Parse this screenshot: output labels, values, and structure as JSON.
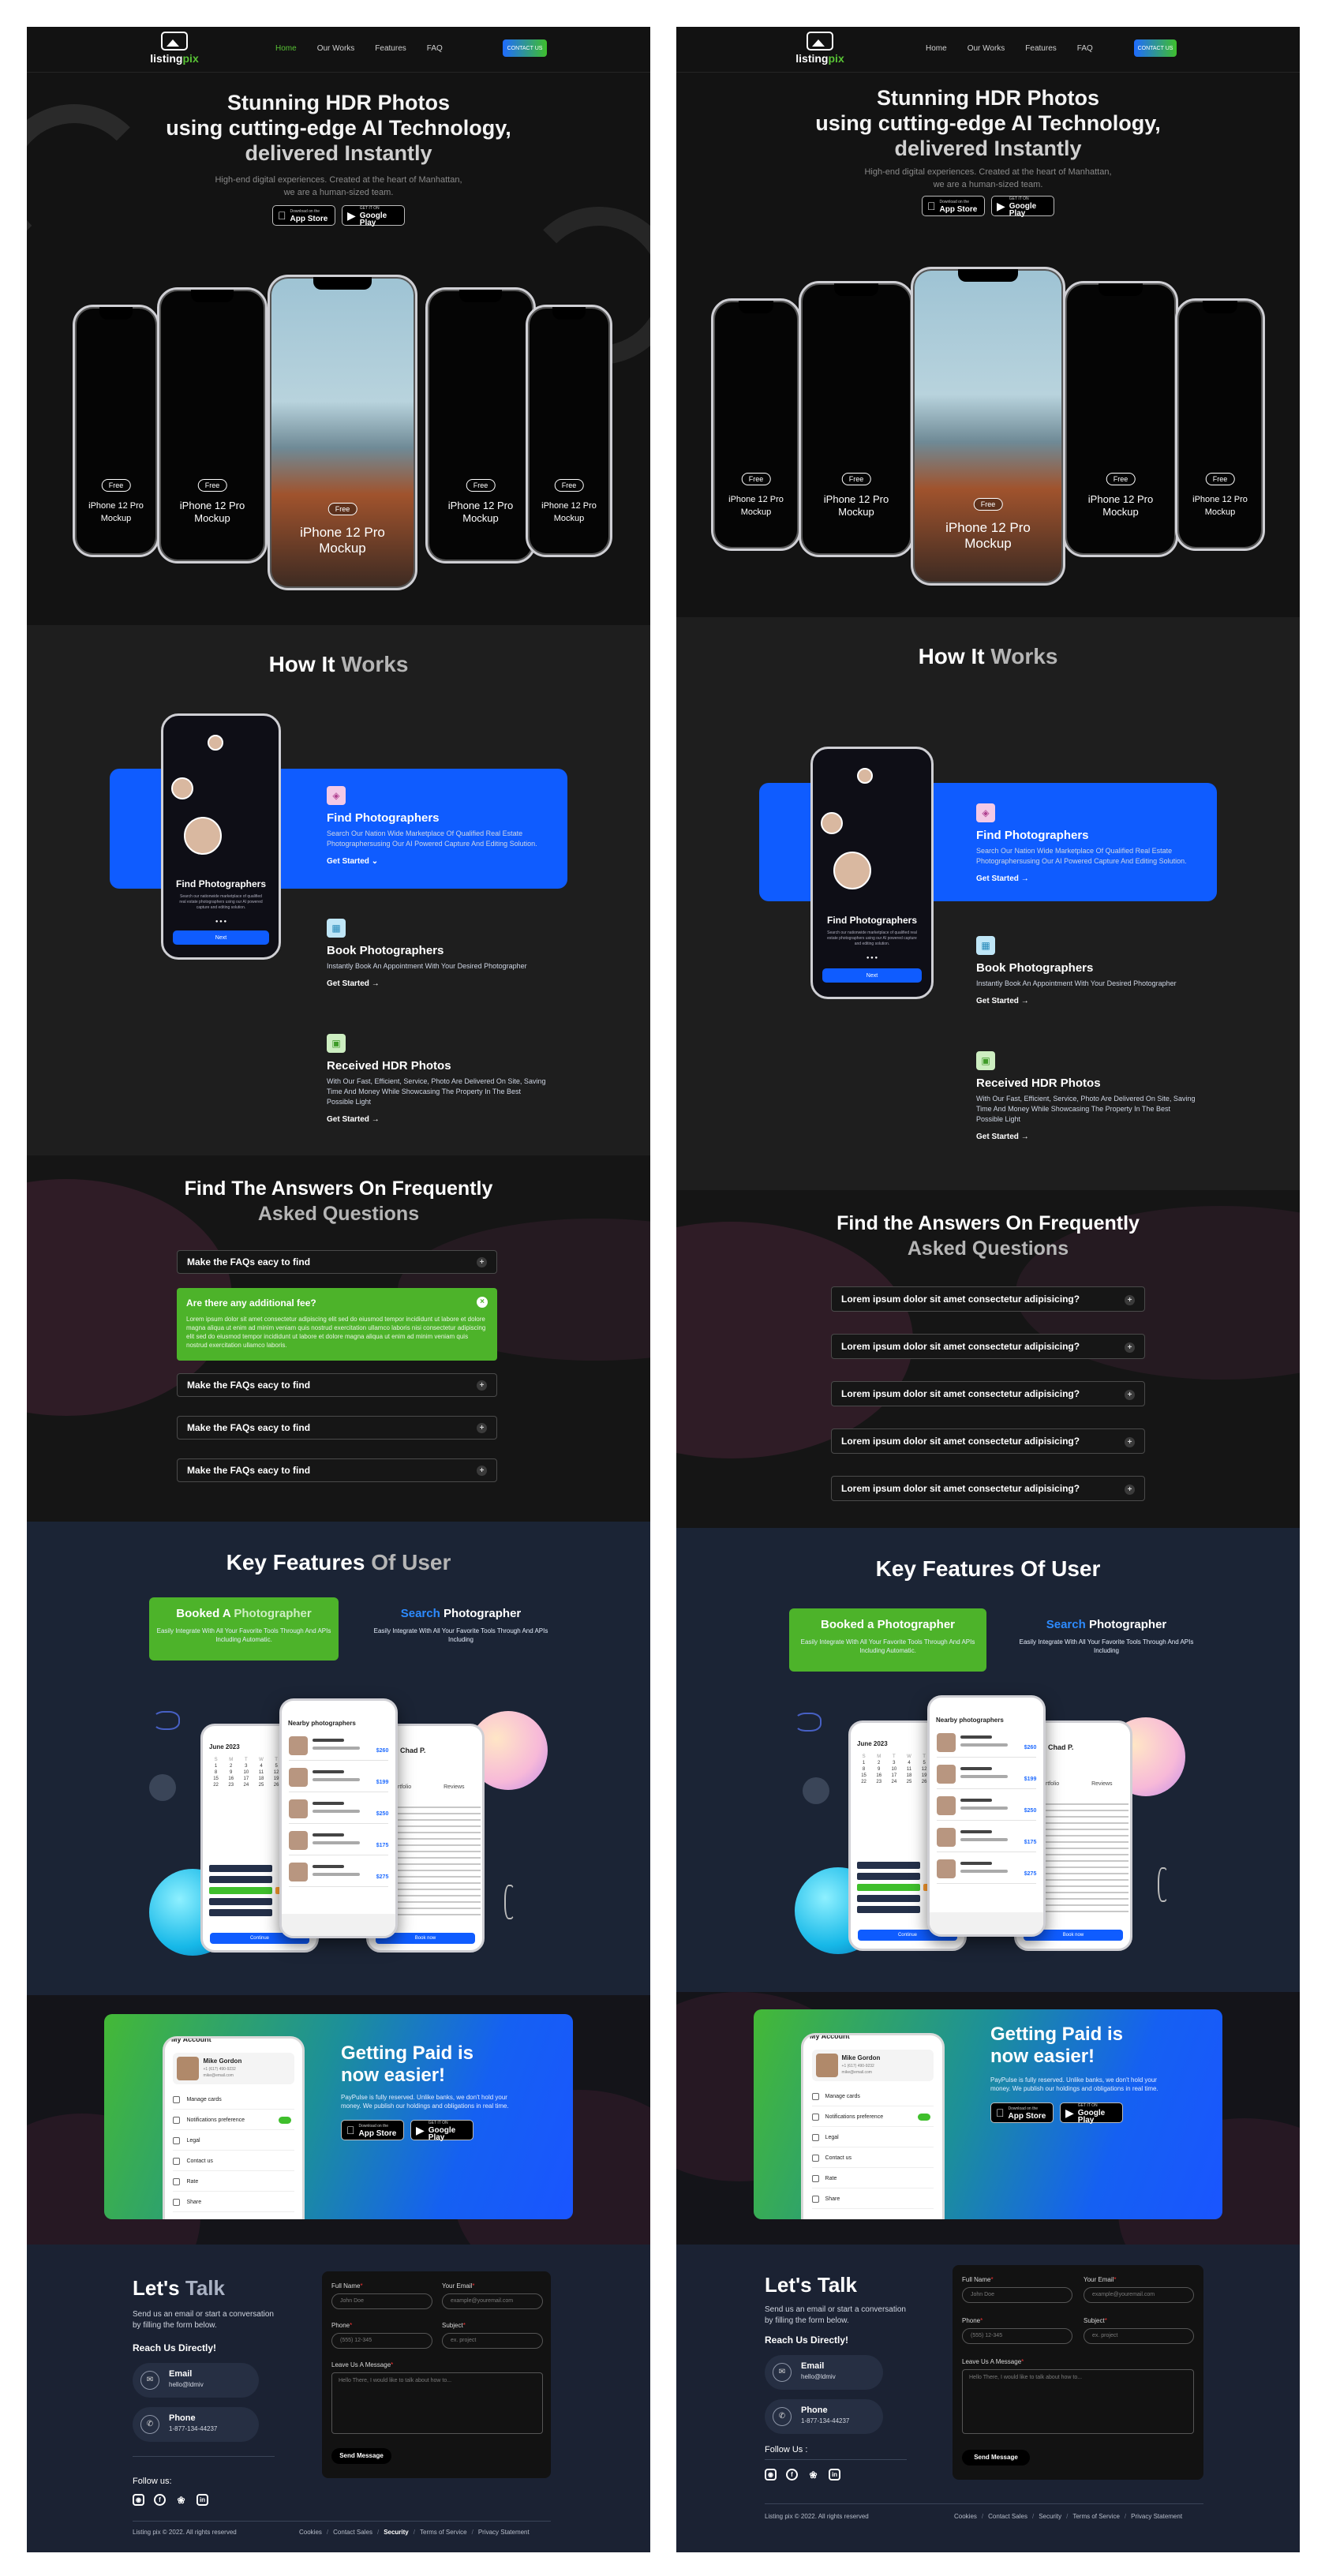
{
  "nav": {
    "logo": {
      "word_main": "listing",
      "word_accent": "pix"
    },
    "links": [
      "Home",
      "Our Works",
      "Features",
      "FAQ"
    ],
    "contact_button": "CONTACT US"
  },
  "hero": {
    "title_line1": "Stunning HDR Photos",
    "title_line2": "using cutting-edge AI Technology,",
    "title_line3": "delivered Instantly",
    "subtitle": "High-end digital experiences. Created at the heart of Manhattan, we are a human-sized team.",
    "app_store_small": "Download on the",
    "app_store_big": "App Store",
    "google_play_small": "GET IT ON",
    "google_play_big": "Google Play",
    "phone_badge": "Free",
    "phone_label_line1": "iPhone 12 Pro",
    "phone_label_line2": "Mockup"
  },
  "how": {
    "title_main": "How It",
    "title_dim": "Works",
    "phone_title": "Find Photographers",
    "phone_desc": "Search our nationwide marketplace of qualified real estate photographers using our AI powered capture and editing solution.",
    "phone_dots": "● ● ●",
    "phone_button": "Next",
    "steps": [
      {
        "title": "Find Photographers",
        "cta": "Get Started"
      },
      {
        "title": "Book Photographers",
        "desc": "Instantly Book An Appointment With Your Desired Photographer",
        "cta": "Get Started"
      },
      {
        "title": "Received HDR Photos",
        "desc": "With Our Fast, Efficient, Service, Photo Are Delivered On Site, Saving Time And Money While Showcasing The Property In The Best Possible Light",
        "cta": "Get Started"
      }
    ],
    "step1_desc_left": "Search Our Nation Wide Marketplace Of Qualified Real Estate Photographersusing Our AI Powered Capture And Editing Solution.",
    "step1_desc_right": "Search Our Nation Wide Marketplace Of Qualified Real Estate Photographersusing Our AI Powered Capture And Editing Solution."
  },
  "faq_left": {
    "title_line1": "Find The Answers On Frequently",
    "title_line2": "Asked Questions",
    "item1": "Make the FAQs eacy to find",
    "open_question": "Are there any additional fee?",
    "open_answer": "Lorem ipsum dolor sit amet consectetur adipiscing elit sed do eiusmod tempor incididunt ut labore et dolore magna aliqua ut enim ad minim veniam quis nostrud exercitation ullamco laboris nisi consectetur adipiscing elit sed do eiusmod tempor incididunt ut labore et dolore magna aliqua ut enim ad minim veniam quis nostrud exercitation ullamco laboris.",
    "item3": "Make the FAQs eacy to find",
    "item4": "Make the FAQs eacy to find",
    "item5": "Make the FAQs eacy to find"
  },
  "faq_right": {
    "title_line1": "Find the Answers On Frequently",
    "title_line2": "Asked Questions",
    "items": [
      "Lorem ipsum dolor sit amet consectetur adipisicing?",
      "Lorem ipsum dolor sit amet consectetur adipisicing?",
      "Lorem ipsum dolor sit amet consectetur adipisicing?",
      "Lorem ipsum dolor sit amet consectetur adipisicing?",
      "Lorem ipsum dolor sit amet consectetur adipisicing?"
    ]
  },
  "features": {
    "title_main": "Key Features",
    "title_dim": "Of User",
    "tab1_accent_left": "Booked A",
    "tab1_rest_left": "Photographer",
    "tab1_right": "Booked a Photographer",
    "tab1_desc": "Easily Integrate With All Your Favorite Tools Through And APIs Including Automatic.",
    "tab2_accent": "Search",
    "tab2_rest": "Photographer",
    "tab2_desc": "Easily Integrate With All Your Favorite Tools Through And APIs Including",
    "phone_header": "Nearby photographers",
    "calendar_month": "June 2023",
    "calendar_days": [
      "S",
      "M",
      "T",
      "W",
      "T",
      "F",
      "S",
      "1",
      "2",
      "3",
      "4",
      "5",
      "6",
      "7",
      "8",
      "9",
      "10",
      "11",
      "12",
      "13",
      "14",
      "15",
      "16",
      "17",
      "18",
      "19",
      "20",
      "21",
      "22",
      "23",
      "24",
      "25",
      "26",
      "27",
      "28"
    ],
    "prices": [
      "$260",
      "$199",
      "$250",
      "$175",
      "$275"
    ],
    "continue_button": "Continue",
    "book_button": "Book now",
    "right_phone_name": "Chad P.",
    "tab_portfolio": "Portfolio",
    "tab_reviews": "Reviews"
  },
  "paid": {
    "title_line1": "Getting Paid is",
    "title_line2": "now easier!",
    "desc": "PayPulse is fully reserved. Unlike banks, we don't hold your money. We publish our holdings and obligations in real time.",
    "profile_name": "Mike Gordon",
    "profile_phone": "+1 (617) 490-9232",
    "profile_email": "mike@email.com",
    "menu": [
      "Manage cards",
      "Notifications preference",
      "Legal",
      "Contact us",
      "Rate",
      "Share"
    ],
    "profile_heading": "My Account"
  },
  "contact": {
    "title_main": "Let's",
    "title_dim": "Talk",
    "subtitle": "Send us an email or start a conversation by filling the form below.",
    "reach": "Reach Us Directly!",
    "email_label": "Email",
    "email_value": "hello@ldmiv",
    "email_value_right": "hello@ldmiv",
    "phone_label": "Phone",
    "phone_value": "1-877-134-44237",
    "follow": "Follow us:",
    "follow_right": "Follow Us :",
    "form": {
      "full_name": "Full Name",
      "full_name_ph": "John Doe",
      "your_email": "Your Email",
      "your_email_ph": "example@youremail.com",
      "phone": "Phone",
      "phone_ph": "(555) 12-345",
      "subject": "Subject",
      "subject_ph": "ex. project",
      "message": "Leave Us A Message",
      "message_ph": "Hello There, I would like to talk about how to...",
      "send": "Send Message"
    },
    "copyright": "Listing pix © 2022. All rights reserved",
    "links": [
      "Cookies",
      "Contact Sales",
      "Security",
      "Terms of Service",
      "Privacy Statement"
    ]
  },
  "colors": {
    "green": "#4db32a",
    "blue": "#0f5cff",
    "dark": "#131313",
    "navy": "#1b2233"
  }
}
